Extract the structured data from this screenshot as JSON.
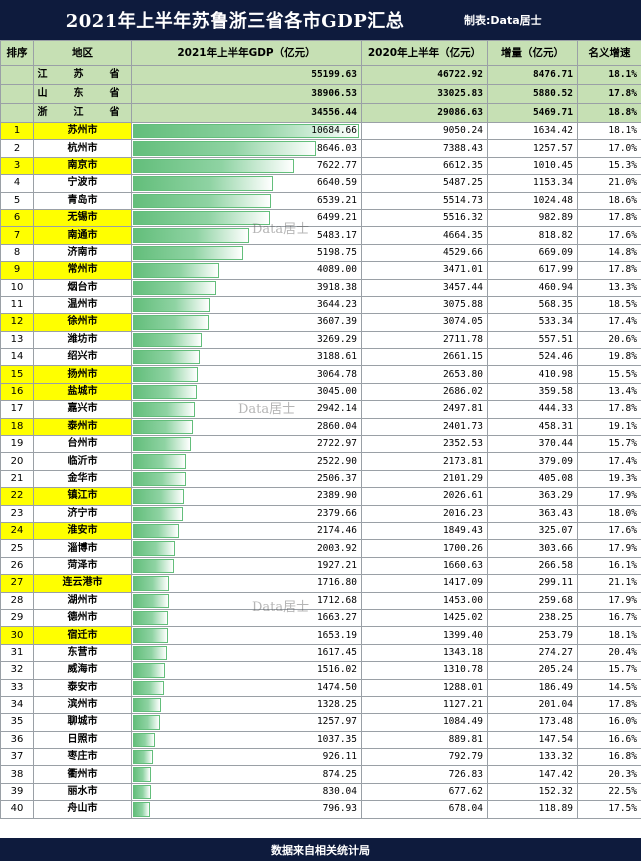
{
  "title": "2021年上半年苏鲁浙三省各市GDP汇总",
  "credit": "制表:Data居士",
  "headers": {
    "rank": "排序",
    "region": "地区",
    "gdp2021": "2021年上半年GDP（亿元）",
    "gdp2020": "2020年上半年（亿元）",
    "increase": "增量（亿元）",
    "growth": "名义增速"
  },
  "provinces": [
    {
      "region": "江　苏　省",
      "gdp2021": "55199.63",
      "gdp2020": "46722.92",
      "increase": "8476.71",
      "growth": "18.1%"
    },
    {
      "region": "山　东　省",
      "gdp2021": "38906.53",
      "gdp2020": "33025.83",
      "increase": "5880.52",
      "growth": "17.8%"
    },
    {
      "region": "浙　江　省",
      "gdp2021": "34556.44",
      "gdp2020": "29086.63",
      "increase": "5469.71",
      "growth": "18.8%"
    }
  ],
  "cities": [
    {
      "rank": "1",
      "region": "苏州市",
      "gdp2021": "10684.66",
      "gdp2020": "9050.24",
      "increase": "1634.42",
      "growth": "18.1%",
      "highlight": true
    },
    {
      "rank": "2",
      "region": "杭州市",
      "gdp2021": "8646.03",
      "gdp2020": "7388.43",
      "increase": "1257.57",
      "growth": "17.0%",
      "highlight": false
    },
    {
      "rank": "3",
      "region": "南京市",
      "gdp2021": "7622.77",
      "gdp2020": "6612.35",
      "increase": "1010.45",
      "growth": "15.3%",
      "highlight": true
    },
    {
      "rank": "4",
      "region": "宁波市",
      "gdp2021": "6640.59",
      "gdp2020": "5487.25",
      "increase": "1153.34",
      "growth": "21.0%",
      "highlight": false
    },
    {
      "rank": "5",
      "region": "青岛市",
      "gdp2021": "6539.21",
      "gdp2020": "5514.73",
      "increase": "1024.48",
      "growth": "18.6%",
      "highlight": false
    },
    {
      "rank": "6",
      "region": "无锡市",
      "gdp2021": "6499.21",
      "gdp2020": "5516.32",
      "increase": "982.89",
      "growth": "17.8%",
      "highlight": true
    },
    {
      "rank": "7",
      "region": "南通市",
      "gdp2021": "5483.17",
      "gdp2020": "4664.35",
      "increase": "818.82",
      "growth": "17.6%",
      "highlight": true
    },
    {
      "rank": "8",
      "region": "济南市",
      "gdp2021": "5198.75",
      "gdp2020": "4529.66",
      "increase": "669.09",
      "growth": "14.8%",
      "highlight": false
    },
    {
      "rank": "9",
      "region": "常州市",
      "gdp2021": "4089.00",
      "gdp2020": "3471.01",
      "increase": "617.99",
      "growth": "17.8%",
      "highlight": true
    },
    {
      "rank": "10",
      "region": "烟台市",
      "gdp2021": "3918.38",
      "gdp2020": "3457.44",
      "increase": "460.94",
      "growth": "13.3%",
      "highlight": false
    },
    {
      "rank": "11",
      "region": "温州市",
      "gdp2021": "3644.23",
      "gdp2020": "3075.88",
      "increase": "568.35",
      "growth": "18.5%",
      "highlight": false
    },
    {
      "rank": "12",
      "region": "徐州市",
      "gdp2021": "3607.39",
      "gdp2020": "3074.05",
      "increase": "533.34",
      "growth": "17.4%",
      "highlight": true
    },
    {
      "rank": "13",
      "region": "潍坊市",
      "gdp2021": "3269.29",
      "gdp2020": "2711.78",
      "increase": "557.51",
      "growth": "20.6%",
      "highlight": false
    },
    {
      "rank": "14",
      "region": "绍兴市",
      "gdp2021": "3188.61",
      "gdp2020": "2661.15",
      "increase": "524.46",
      "growth": "19.8%",
      "highlight": false
    },
    {
      "rank": "15",
      "region": "扬州市",
      "gdp2021": "3064.78",
      "gdp2020": "2653.80",
      "increase": "410.98",
      "growth": "15.5%",
      "highlight": true
    },
    {
      "rank": "16",
      "region": "盐城市",
      "gdp2021": "3045.00",
      "gdp2020": "2686.02",
      "increase": "359.58",
      "growth": "13.4%",
      "highlight": true
    },
    {
      "rank": "17",
      "region": "嘉兴市",
      "gdp2021": "2942.14",
      "gdp2020": "2497.81",
      "increase": "444.33",
      "growth": "17.8%",
      "highlight": false
    },
    {
      "rank": "18",
      "region": "泰州市",
      "gdp2021": "2860.04",
      "gdp2020": "2401.73",
      "increase": "458.31",
      "growth": "19.1%",
      "highlight": true
    },
    {
      "rank": "19",
      "region": "台州市",
      "gdp2021": "2722.97",
      "gdp2020": "2352.53",
      "increase": "370.44",
      "growth": "15.7%",
      "highlight": false
    },
    {
      "rank": "20",
      "region": "临沂市",
      "gdp2021": "2522.90",
      "gdp2020": "2173.81",
      "increase": "379.09",
      "growth": "17.4%",
      "highlight": false
    },
    {
      "rank": "21",
      "region": "金华市",
      "gdp2021": "2506.37",
      "gdp2020": "2101.29",
      "increase": "405.08",
      "growth": "19.3%",
      "highlight": false
    },
    {
      "rank": "22",
      "region": "镇江市",
      "gdp2021": "2389.90",
      "gdp2020": "2026.61",
      "increase": "363.29",
      "growth": "17.9%",
      "highlight": true
    },
    {
      "rank": "23",
      "region": "济宁市",
      "gdp2021": "2379.66",
      "gdp2020": "2016.23",
      "increase": "363.43",
      "growth": "18.0%",
      "highlight": false
    },
    {
      "rank": "24",
      "region": "淮安市",
      "gdp2021": "2174.46",
      "gdp2020": "1849.43",
      "increase": "325.07",
      "growth": "17.6%",
      "highlight": true
    },
    {
      "rank": "25",
      "region": "淄博市",
      "gdp2021": "2003.92",
      "gdp2020": "1700.26",
      "increase": "303.66",
      "growth": "17.9%",
      "highlight": false
    },
    {
      "rank": "26",
      "region": "菏泽市",
      "gdp2021": "1927.21",
      "gdp2020": "1660.63",
      "increase": "266.58",
      "growth": "16.1%",
      "highlight": false
    },
    {
      "rank": "27",
      "region": "连云港市",
      "gdp2021": "1716.80",
      "gdp2020": "1417.09",
      "increase": "299.11",
      "growth": "21.1%",
      "highlight": true
    },
    {
      "rank": "28",
      "region": "湖州市",
      "gdp2021": "1712.68",
      "gdp2020": "1453.00",
      "increase": "259.68",
      "growth": "17.9%",
      "highlight": false
    },
    {
      "rank": "29",
      "region": "德州市",
      "gdp2021": "1663.27",
      "gdp2020": "1425.02",
      "increase": "238.25",
      "growth": "16.7%",
      "highlight": false
    },
    {
      "rank": "30",
      "region": "宿迁市",
      "gdp2021": "1653.19",
      "gdp2020": "1399.40",
      "increase": "253.79",
      "growth": "18.1%",
      "highlight": true
    },
    {
      "rank": "31",
      "region": "东营市",
      "gdp2021": "1617.45",
      "gdp2020": "1343.18",
      "increase": "274.27",
      "growth": "20.4%",
      "highlight": false
    },
    {
      "rank": "32",
      "region": "威海市",
      "gdp2021": "1516.02",
      "gdp2020": "1310.78",
      "increase": "205.24",
      "growth": "15.7%",
      "highlight": false
    },
    {
      "rank": "33",
      "region": "泰安市",
      "gdp2021": "1474.50",
      "gdp2020": "1288.01",
      "increase": "186.49",
      "growth": "14.5%",
      "highlight": false
    },
    {
      "rank": "34",
      "region": "滨州市",
      "gdp2021": "1328.25",
      "gdp2020": "1127.21",
      "increase": "201.04",
      "growth": "17.8%",
      "highlight": false
    },
    {
      "rank": "35",
      "region": "聊城市",
      "gdp2021": "1257.97",
      "gdp2020": "1084.49",
      "increase": "173.48",
      "growth": "16.0%",
      "highlight": false
    },
    {
      "rank": "36",
      "region": "日照市",
      "gdp2021": "1037.35",
      "gdp2020": "889.81",
      "increase": "147.54",
      "growth": "16.6%",
      "highlight": false
    },
    {
      "rank": "37",
      "region": "枣庄市",
      "gdp2021": "926.11",
      "gdp2020": "792.79",
      "increase": "133.32",
      "growth": "16.8%",
      "highlight": false
    },
    {
      "rank": "38",
      "region": "衢州市",
      "gdp2021": "874.25",
      "gdp2020": "726.83",
      "increase": "147.42",
      "growth": "20.3%",
      "highlight": false
    },
    {
      "rank": "39",
      "region": "丽水市",
      "gdp2021": "830.04",
      "gdp2020": "677.62",
      "increase": "152.32",
      "growth": "22.5%",
      "highlight": false
    },
    {
      "rank": "40",
      "region": "舟山市",
      "gdp2021": "796.93",
      "gdp2020": "678.04",
      "increase": "118.89",
      "growth": "17.5%",
      "highlight": false
    }
  ],
  "watermark": "Data居士",
  "footer": "数据来自相关统计局",
  "colors": {
    "header_bg": "#0e1b3d",
    "header_green": "#c6e0b4",
    "highlight": "#ffff00",
    "bar": "#63be7b"
  }
}
